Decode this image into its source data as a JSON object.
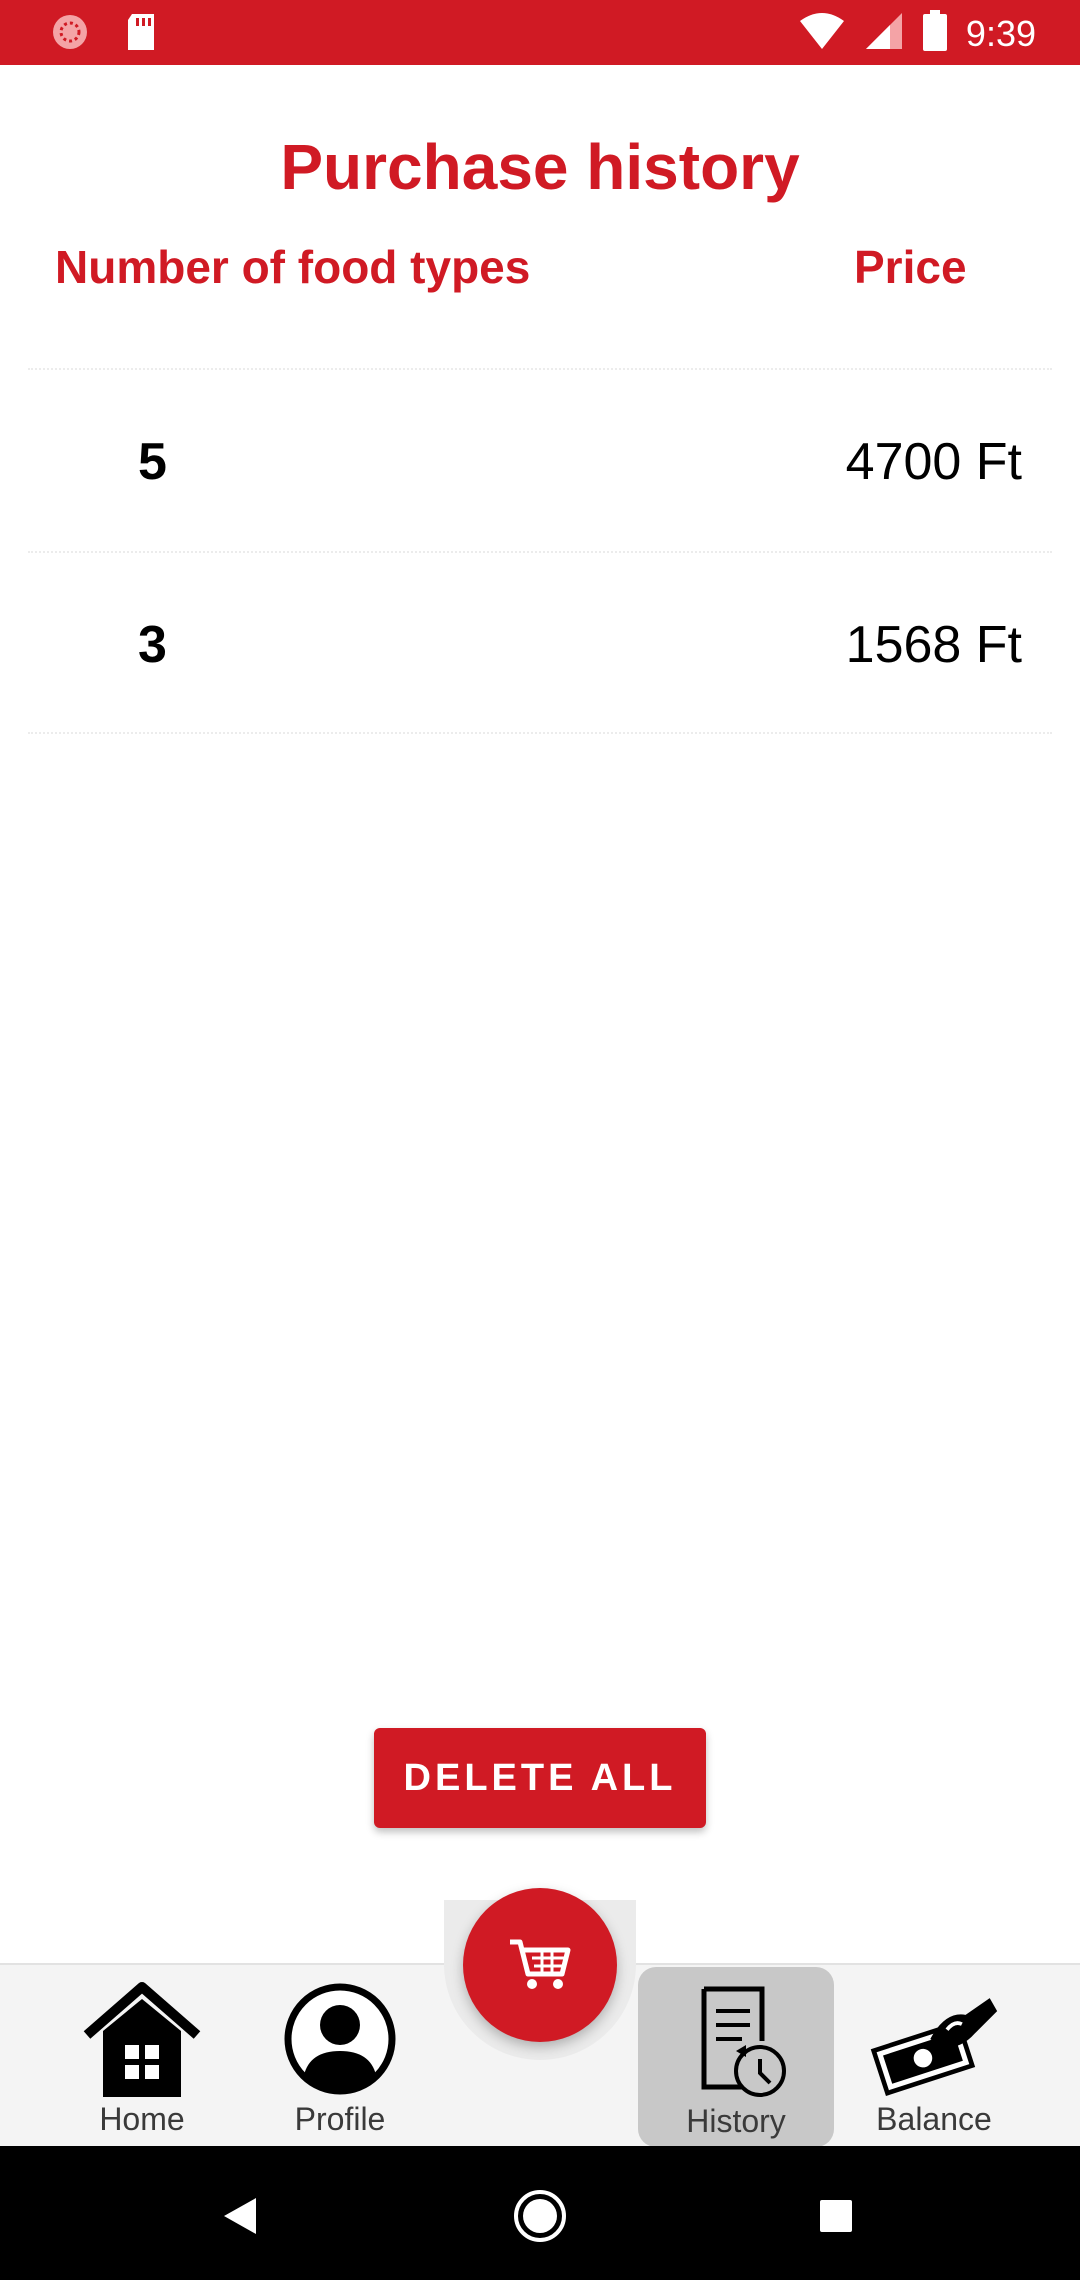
{
  "status_bar": {
    "time": "9:39",
    "icons": [
      "notification-icon",
      "sd-card-icon",
      "wifi-icon",
      "signal-icon",
      "battery-icon"
    ]
  },
  "page": {
    "title": "Purchase history",
    "columns": {
      "count": "Number of food types",
      "price": "Price"
    }
  },
  "purchases": [
    {
      "count": "5",
      "price": "4700 Ft"
    },
    {
      "count": "3",
      "price": "1568 Ft"
    }
  ],
  "actions": {
    "delete_all": "DELETE ALL"
  },
  "bottom_nav": {
    "home": "Home",
    "profile": "Profile",
    "history": "History",
    "balance": "Balance",
    "active": "history",
    "cart_icon": "shopping-cart-icon"
  },
  "colors": {
    "accent": "#d01a24",
    "nav_background": "#f4f4f4",
    "nav_active": "#c8c8c8"
  }
}
